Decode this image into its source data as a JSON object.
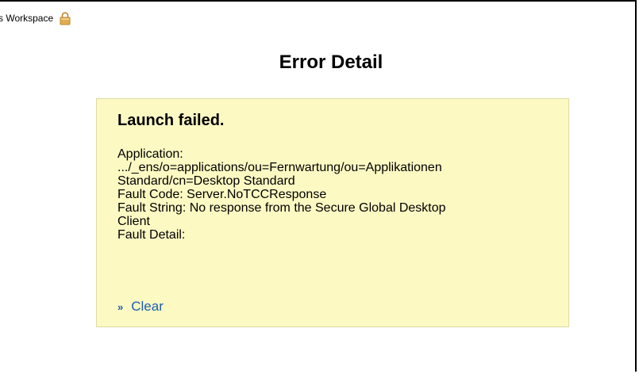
{
  "header": {
    "workspace_label": "s Workspace",
    "lock_icon": "lock-icon"
  },
  "page": {
    "title": "Error Detail"
  },
  "error": {
    "heading": "Launch failed.",
    "lines": [
      "Application:",
      ".../_ens/o=applications/ou=Fernwartung/ou=Applikationen",
      "Standard/cn=Desktop Standard",
      "Fault Code: Server.NoTCCResponse",
      "Fault String: No response from the Secure Global Desktop",
      "Client",
      "Fault Detail:"
    ],
    "clear_label": "Clear",
    "chevron_icon": "double-chevron-right-icon"
  },
  "colors": {
    "box_background": "#fcf9c3",
    "box_border": "#dcdca0",
    "link": "#1a5fb4",
    "lock": "#d9a441"
  }
}
